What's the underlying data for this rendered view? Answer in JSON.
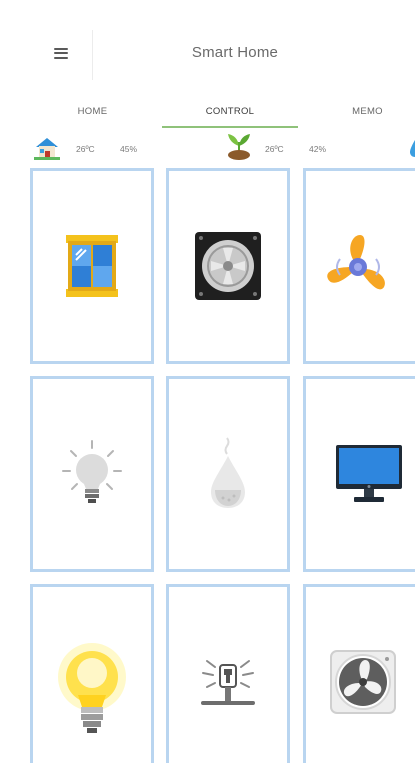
{
  "header": {
    "title": "Smart Home",
    "menu_icon": "menu-icon"
  },
  "tabs": [
    {
      "label": "HOME"
    },
    {
      "label": "CONTROL",
      "active": true
    },
    {
      "label": "MEMO"
    }
  ],
  "status": {
    "home": {
      "temperature": "26ºC",
      "humidity": "45%"
    },
    "plant": {
      "temperature": "26ºC",
      "humidity": "42%"
    }
  },
  "devices": [
    {
      "icon": "window-icon"
    },
    {
      "icon": "exhaust-fan-icon"
    },
    {
      "icon": "ceiling-fan-icon"
    },
    {
      "icon": "light-bulb-icon"
    },
    {
      "icon": "humidifier-icon"
    },
    {
      "icon": "monitor-icon"
    },
    {
      "icon": "light-bulb-on-icon"
    },
    {
      "icon": "sprinkler-icon"
    },
    {
      "icon": "vent-fan-icon"
    }
  ],
  "colors": {
    "accent": "#8fc27a",
    "tile_border": "#b9d5f0"
  }
}
